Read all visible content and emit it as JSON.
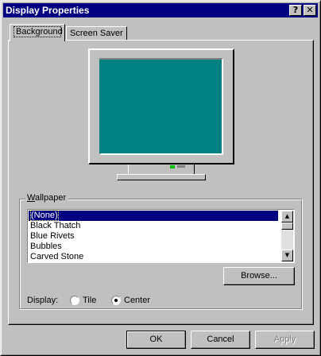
{
  "window": {
    "title": "Display Properties"
  },
  "titlebar_buttons": {
    "help": "?",
    "close": "✕"
  },
  "tabs": [
    {
      "label": "Background",
      "active": true
    },
    {
      "label": "Screen Saver",
      "active": false
    }
  ],
  "monitor": {
    "screen_color": "#008080"
  },
  "wallpaper": {
    "group_label": "Wallpaper",
    "items": [
      "(None)",
      "Black Thatch",
      "Blue Rivets",
      "Bubbles",
      "Carved Stone"
    ],
    "selected_index": 0,
    "browse_label": "Browse..."
  },
  "display": {
    "label": "Display:",
    "options": [
      {
        "label": "Tile",
        "checked": false
      },
      {
        "label": "Center",
        "checked": true
      }
    ]
  },
  "buttons": {
    "ok": "OK",
    "cancel": "Cancel",
    "apply": "Apply"
  },
  "colors": {
    "title_bar": "#000080",
    "face": "#c0c0c0",
    "selection": "#000080"
  }
}
